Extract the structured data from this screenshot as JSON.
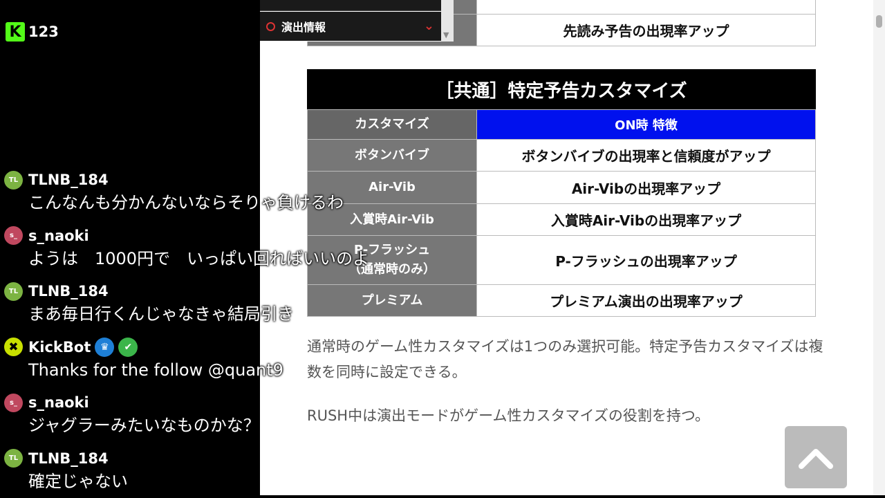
{
  "stream": {
    "viewer_count": "123"
  },
  "webpage": {
    "nav": {
      "item_label": "演出情報"
    },
    "top_table": {
      "rows": [
        {
          "value": "先読み予告の出現率アップ"
        }
      ]
    },
    "customize_section": {
      "title": "［共通］特定予告カスタマイズ",
      "header": {
        "col1": "カスタマイズ",
        "col2": "ON時 特徴"
      },
      "rows": [
        {
          "name": "ボタンバイブ",
          "feature": "ボタンバイブの出現率と信頼度がアップ"
        },
        {
          "name": "Air-Vib",
          "feature": "Air-Vibの出現率アップ"
        },
        {
          "name": "入賞時Air-Vib",
          "feature": "入賞時Air-Vibの出現率アップ"
        },
        {
          "name": "P-フラッシュ\n（通常時のみ）",
          "feature": "P-フラッシュの出現率アップ"
        },
        {
          "name": "プレミアム",
          "feature": "プレミアム演出の出現率アップ"
        }
      ]
    },
    "paragraph1": "通常時のゲーム性カスタマイズは1つのみ選択可能。特定予告カスタマイズは複数を同時に設定できる。",
    "paragraph2": "RUSH中は演出モードがゲーム性カスタマイズの役割を持つ。"
  },
  "chat": {
    "messages": [
      {
        "avatar": "TL",
        "avatar_color": "#7cb342",
        "username": "TLNB_184",
        "text": "こんなんも分かんないならそりゃ負けるわ"
      },
      {
        "avatar": "s_",
        "avatar_color": "#c0485f",
        "username": "s_naoki",
        "text": "ようは　1000円で　いっぱい回ればいいのよ"
      },
      {
        "avatar": "TL",
        "avatar_color": "#7cb342",
        "username": "TLNB_184",
        "text": "まあ毎日行くんじゃなきゃ結局引き"
      },
      {
        "avatar": "bot",
        "avatar_color": "#c8e000",
        "username": "KickBot",
        "text": "Thanks for the follow @quant9",
        "badges": [
          "crown",
          "verified"
        ]
      },
      {
        "avatar": "s_",
        "avatar_color": "#c0485f",
        "username": "s_naoki",
        "text": "ジャグラーみたいなものかな？"
      },
      {
        "avatar": "TL",
        "avatar_color": "#7cb342",
        "username": "TLNB_184",
        "text": "確定じゃない"
      }
    ]
  }
}
